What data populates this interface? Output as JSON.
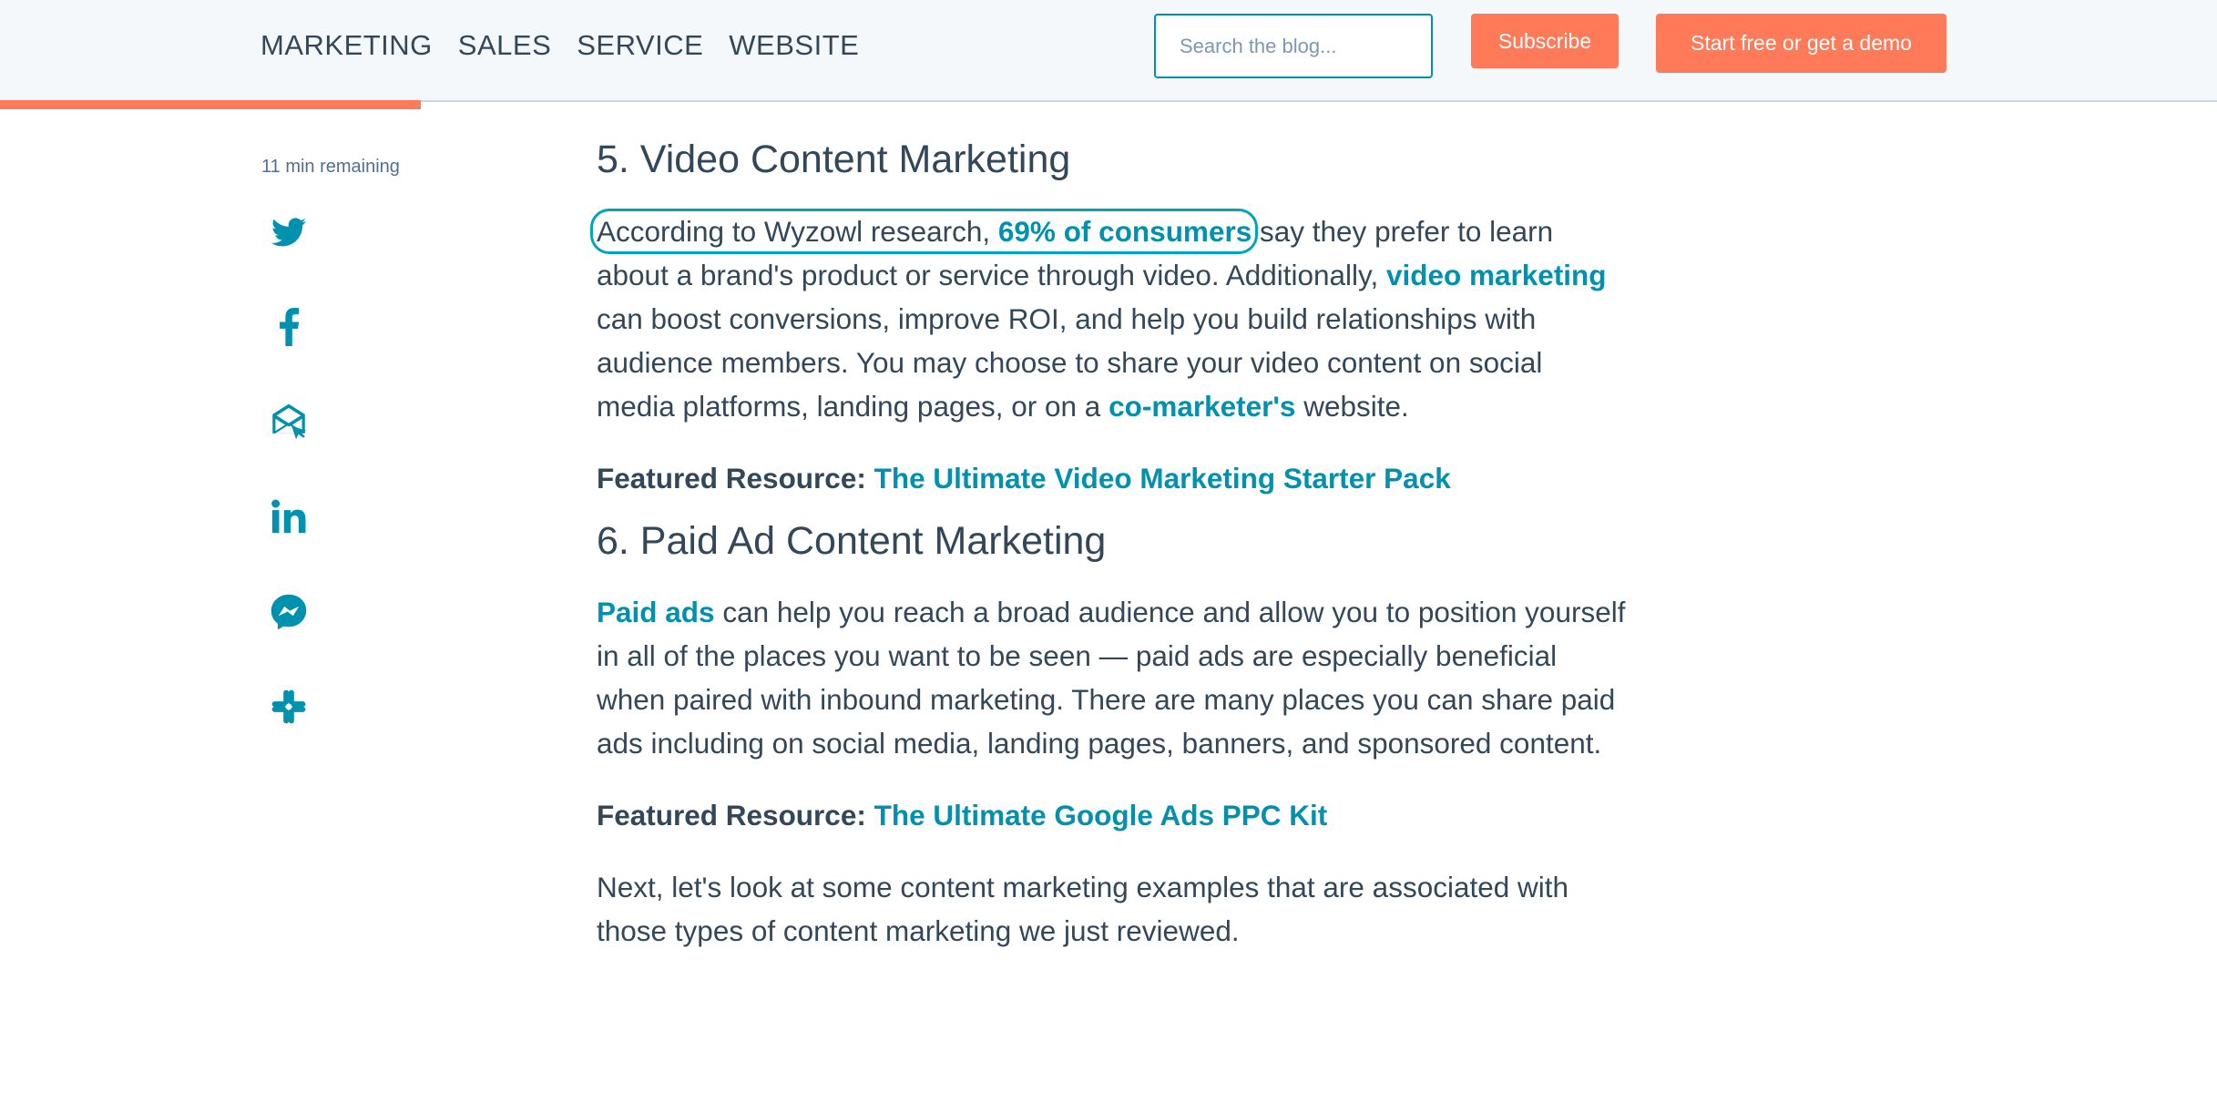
{
  "nav": {
    "items": [
      "MARKETING",
      "SALES",
      "SERVICE",
      "WEBSITE"
    ]
  },
  "search": {
    "placeholder": "Search the blog...",
    "icon": "search-icon"
  },
  "buttons": {
    "subscribe": "Subscribe",
    "demo": "Start free or get a demo"
  },
  "reading_progress": 0.19,
  "sidebar": {
    "remaining": "11 min remaining",
    "share_icons": [
      "twitter-icon",
      "facebook-icon",
      "email-icon",
      "linkedin-icon",
      "messenger-icon",
      "slack-icon"
    ]
  },
  "colors": {
    "accent": "#ff7a59",
    "link": "#0091ae",
    "text": "#33475b",
    "header_bg": "#f5f8fa"
  },
  "article": {
    "s5": {
      "heading": "5. Video Content Marketing",
      "p1_t1": "According to Wyzowl research, ",
      "p1_l1": "69% of consumers",
      "p1_t2": " say they prefer to learn about a brand's product or service through video. Additionally, ",
      "p1_l2": "video marketing",
      "p1_t3": " can boost conversions, improve ROI, and help you build relationships with audience members. You may choose to share your video content on social media platforms, landing pages, or on a ",
      "p1_l3": "co-marketer's",
      "p1_t4": " website.",
      "featured_label": "Featured Resource:",
      "featured_link": "The Ultimate Video Marketing Starter Pack"
    },
    "s6": {
      "heading": "6. Paid Ad Content Marketing",
      "p1_l1": "Paid ads",
      "p1_t1": " can help you reach a broad audience and allow you to position yourself in all of the places you want to be seen — paid ads are especially beneficial when paired with inbound marketing. There are many places you can share paid ads including on social media, landing pages, banners, and sponsored content.",
      "featured_label": "Featured Resource:",
      "featured_link": "The Ultimate Google Ads PPC Kit"
    },
    "next": "Next, let's look at some content marketing examples that are associated with those types of content marketing we just reviewed."
  }
}
